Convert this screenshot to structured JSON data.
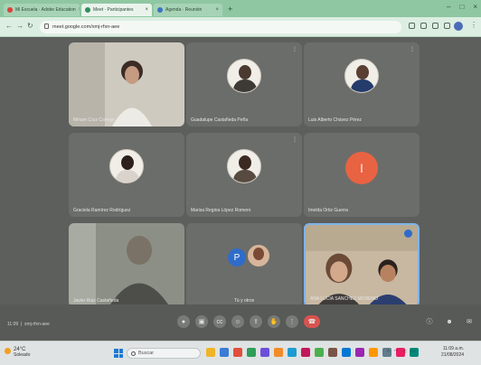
{
  "browser": {
    "tabs": [
      {
        "label": "Mi Escuela · Adobe Education",
        "fav_color": "#d9413b"
      },
      {
        "label": "Meet · Participantes",
        "fav_color": "#2f8f5a"
      },
      {
        "label": "Agenda · Reunión",
        "fav_color": "#3b73c4"
      }
    ],
    "url": "meet.google.com/xmj-rfxn-aee"
  },
  "tiles": [
    {
      "name": "Miriam Cruz Cornejo",
      "type": "camera"
    },
    {
      "name": "Guadalupe Castañeda Peña",
      "type": "avatar"
    },
    {
      "name": "Luis Alberto Chávez Pérez",
      "type": "avatar"
    },
    {
      "name": "Graciela Ramírez Rodríguez",
      "type": "avatar"
    },
    {
      "name": "Marisa Regina López Romero",
      "type": "avatar"
    },
    {
      "name": "Imelda Ortiz Guerra",
      "type": "letter",
      "letter": "I"
    },
    {
      "name": "Javier Ruiz Castañeda",
      "type": "camera"
    },
    {
      "name": "Tú y otros",
      "type": "group",
      "letter": "P"
    },
    {
      "name": "ANA LUCIA SANCHEZ MORENO",
      "type": "camera"
    }
  ],
  "meeting_bar": {
    "time": "11:09",
    "code": "xmj-rfxn-aee",
    "controls": [
      "mic",
      "cam",
      "cc",
      "emoji",
      "present",
      "hand",
      "more"
    ],
    "right_controls": [
      "info",
      "people",
      "chat"
    ]
  },
  "taskbar": {
    "temp": "24°C",
    "weather": "Soleado",
    "search_placeholder": "Buscar",
    "apps": [
      "#f0b429",
      "#3a7bd5",
      "#e04f3c",
      "#2e9e5b",
      "#6c4fd8",
      "#f28c28",
      "#1d9bd1",
      "#c2185b",
      "#4caf50",
      "#795548",
      "#0078d4",
      "#9c27b0",
      "#ff9800",
      "#607d8b",
      "#e91e63",
      "#00897b"
    ],
    "clock_time": "11:09 a.m.",
    "clock_date": "21/08/2024"
  },
  "colors": {
    "meet_bg": "#5d5f5c",
    "tile_bg": "#6b6d6a",
    "end_call": "#d9534f",
    "letter_avatar": "#e86342",
    "accent_blue": "#2f6cc9"
  }
}
